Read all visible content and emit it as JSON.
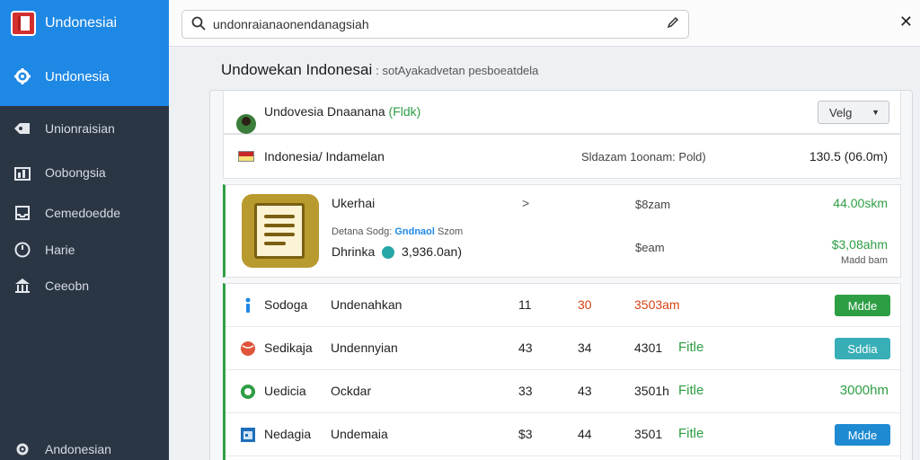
{
  "sidebar": {
    "brand": "Undonesiai",
    "active_item": "Undonesia",
    "items": [
      {
        "label": "Unionraisian",
        "icon": "tag-icon"
      },
      {
        "label": "Oobongsia",
        "icon": "chart-icon"
      },
      {
        "label": "Cemedoedde",
        "icon": "inbox-icon"
      },
      {
        "label": "Harie",
        "icon": "clock-icon"
      },
      {
        "label": "Ceeobn",
        "icon": "bank-icon"
      }
    ],
    "footer_item": "Andonesian"
  },
  "topbar": {
    "search_value": "undonraianaonendanagsiah"
  },
  "page": {
    "title": "Undowekan Indonesai",
    "subtitle": ": sotAyakadvetan pesboeatdela"
  },
  "panel": {
    "header": {
      "name": "Undovesia Dnaanana",
      "tag": "(Fldk)",
      "select_value": "Velg"
    },
    "summary": {
      "label": "Indonesia/ Indamelan",
      "middle": "Sldazam 1oonam: Pold)",
      "right": "130.5 (06.0m)"
    },
    "card": {
      "title": "Ukerhai",
      "chevron": ">",
      "col1_top": "$8zam",
      "right_top": "44.00skm",
      "meta_prefix": "Detana Sodg:",
      "meta_highlight": "Gndnaol",
      "meta_suffix": "Szom",
      "line2_left": "Dhrinka",
      "line2_value": "3,936.0an)",
      "col1_bottom": "$eam",
      "right_bottom": "$3,08ahm",
      "right_bottom_sub": "Madd bam"
    },
    "list": [
      {
        "icon": "person-icon",
        "name": "Sodoga",
        "desc": "Undenahkan",
        "n1": "11",
        "n2": "30",
        "amount": "3503am",
        "status": "",
        "action": "Mdde",
        "action_color": "#2e9e44"
      },
      {
        "icon": "ball-icon",
        "name": "Sedikaja",
        "desc": "Undennyian",
        "n1": "43",
        "n2": "34",
        "amount": "4301",
        "status": "Fitle",
        "action": "Sddia",
        "action_color": "#38aeb6"
      },
      {
        "icon": "shield-icon",
        "name": "Uedicia",
        "desc": "Ockdar",
        "n1": "33",
        "n2": "43",
        "amount": "3501h",
        "status": "Fitle",
        "action": "3000hm",
        "action_color": ""
      },
      {
        "icon": "calendar-icon",
        "name": "Nedagia",
        "desc": "Undemaia",
        "n1": "$3",
        "n2": "44",
        "amount": "3501",
        "status": "Fitle",
        "action": "Mdde",
        "action_color": "#1e8ad2"
      }
    ]
  }
}
